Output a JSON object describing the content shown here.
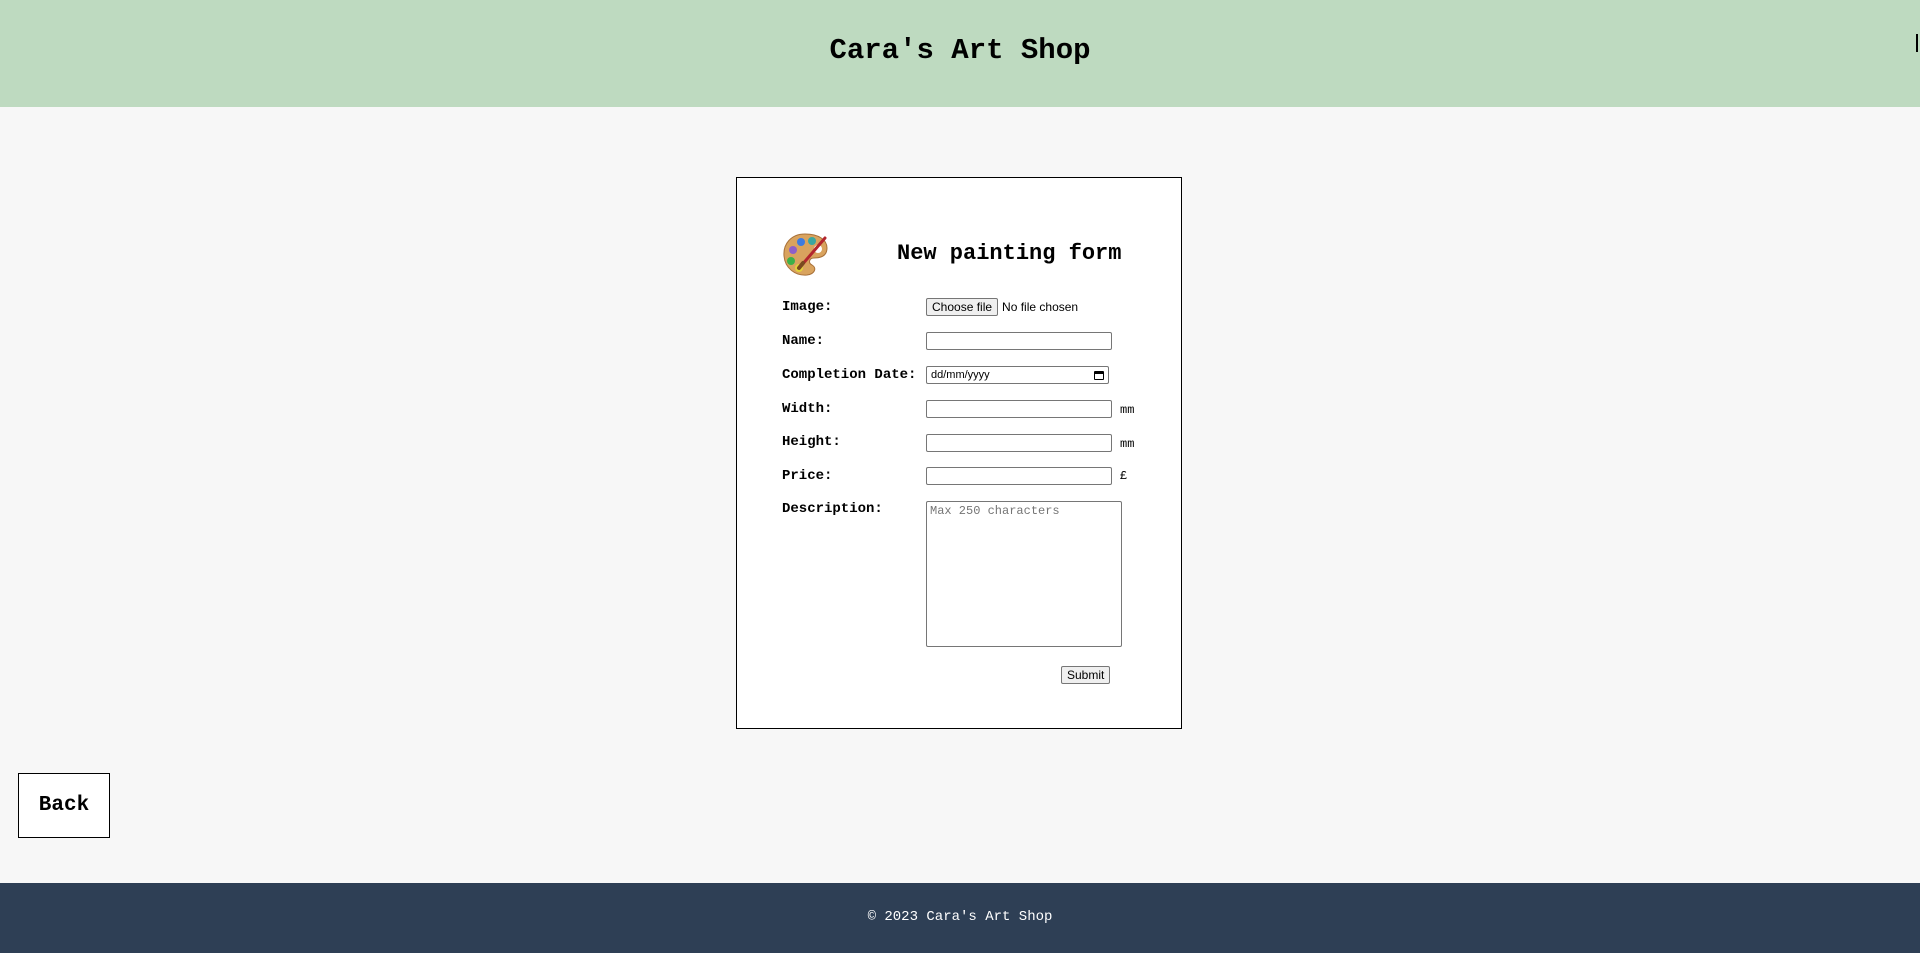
{
  "header": {
    "title": "Cara's Art Shop",
    "background_color": "#bedac0"
  },
  "form": {
    "icon": "artist-palette-icon",
    "title": "New painting form",
    "image": {
      "label": "Image:",
      "button_label": "Choose file",
      "status": "No file chosen"
    },
    "name": {
      "label": "Name:",
      "value": ""
    },
    "completion_date": {
      "label": "Completion Date:",
      "placeholder": "dd/mm/yyyy"
    },
    "width": {
      "label": "Width:",
      "value": "",
      "unit": "mm"
    },
    "height": {
      "label": "Height:",
      "value": "",
      "unit": "mm"
    },
    "price": {
      "label": "Price:",
      "value": "",
      "unit": "£"
    },
    "description": {
      "label": "Description:",
      "placeholder": "Max 250 characters"
    },
    "submit_label": "Submit"
  },
  "navigation": {
    "back_label": "Back"
  },
  "footer": {
    "text": "© 2023 Cara's Art Shop",
    "background_color": "#2e3f55"
  }
}
